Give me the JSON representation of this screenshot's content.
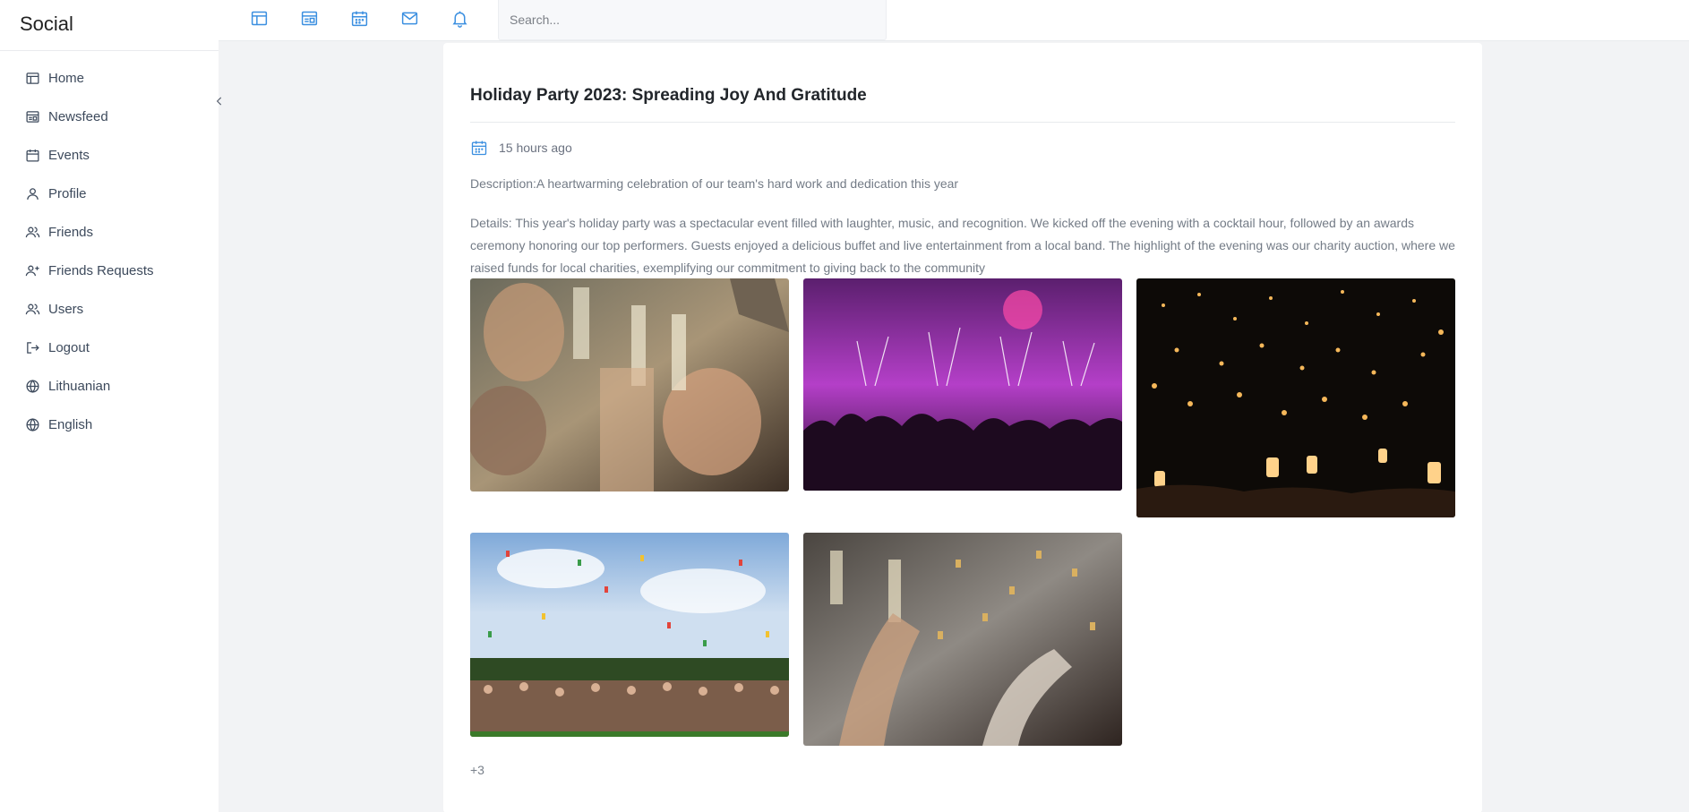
{
  "brand": "Social",
  "nav": {
    "home": "Home",
    "newsfeed": "Newsfeed",
    "events": "Events",
    "profile": "Profile",
    "friends": "Friends",
    "friends_requests": "Friends Requests",
    "users": "Users",
    "logout": "Logout",
    "lithuanian": "Lithuanian",
    "english": "English"
  },
  "topbar": {
    "icons": [
      "home-icon",
      "newsfeed-icon",
      "calendar-icon",
      "mail-icon",
      "bell-icon"
    ],
    "search_placeholder": "Search..."
  },
  "post": {
    "title": "Holiday Party 2023: Spreading Joy And Gratitude",
    "time": "15 hours ago",
    "description": "Description:A heartwarming celebration of our team's hard work and dedication this year",
    "details": "Details: This year's holiday party was a spectacular event filled with laughter, music, and recognition. We kicked off the evening with a cocktail hour, followed by an awards ceremony honoring our top performers. Guests enjoyed a delicious buffet and live entertainment from a local band. The highlight of the evening was our charity auction, where we raised funds for local charities, exemplifying our commitment to giving back to the community",
    "more_photos": "+3"
  },
  "colors": {
    "accent": "#3b8fe0",
    "background": "#f2f3f5",
    "card": "#ffffff"
  }
}
